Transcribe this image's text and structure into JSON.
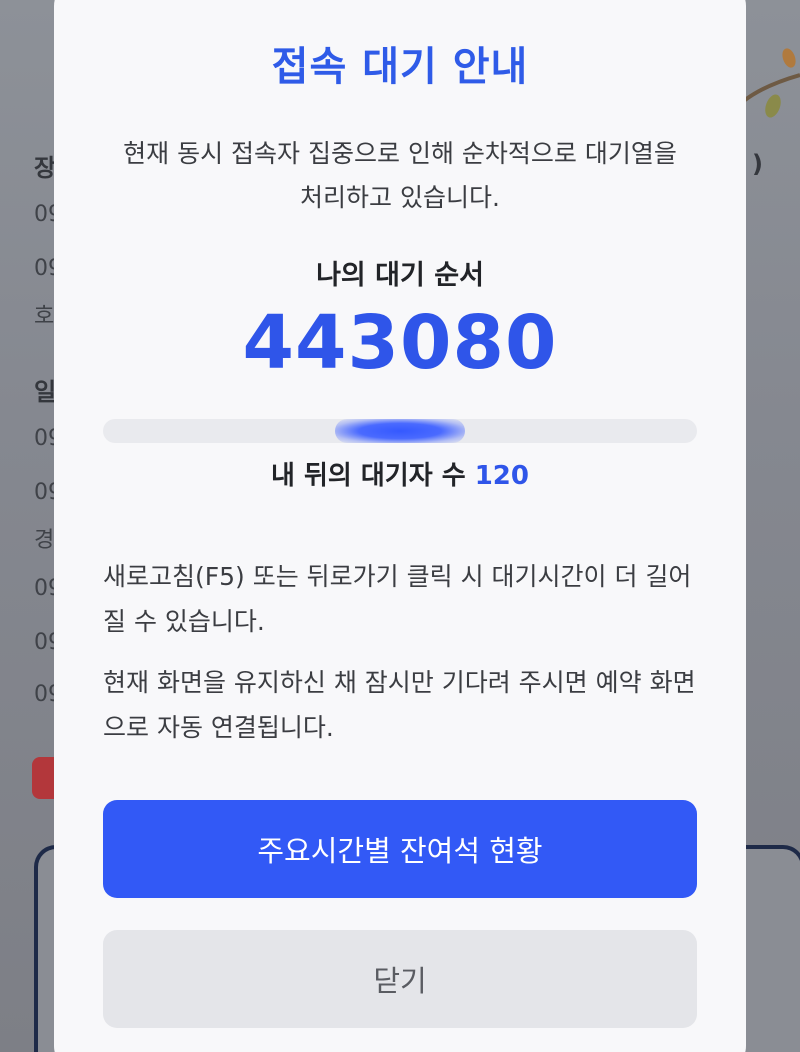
{
  "modal": {
    "title": "접속 대기 안내",
    "description_line1": "현재 동시 접속자 집중으로 인해 순차적으로 대기열을",
    "description_line2": "처리하고 있습니다.",
    "order_label": "나의 대기 순서",
    "order_number": "443080",
    "progress": 0.5,
    "behind_label": "내 뒤의 대기자 수",
    "behind_count": "120",
    "notice1": "새로고침(F5) 또는 뒤로가기 클릭 시 대기시간이 더 길어질 수 있습니다.",
    "notice2": "현재 화면을 유지하신 채 잠시만 기다려 주시면 예약 화면으로 자동 연결됩니다.",
    "primary_button": "주요시간별 잔여석 현황",
    "close_button": "닫기"
  },
  "background_partial": {
    "left_chars": [
      "장",
      "09",
      "09",
      "호",
      "일",
      "09",
      "09",
      "경",
      "09",
      "09",
      "09"
    ],
    "right_char": ")"
  },
  "colors": {
    "accent": "#2f55e9",
    "primary_button": "#3259f6",
    "close_button": "#e4e5e9",
    "overlay": "#7f8289"
  }
}
